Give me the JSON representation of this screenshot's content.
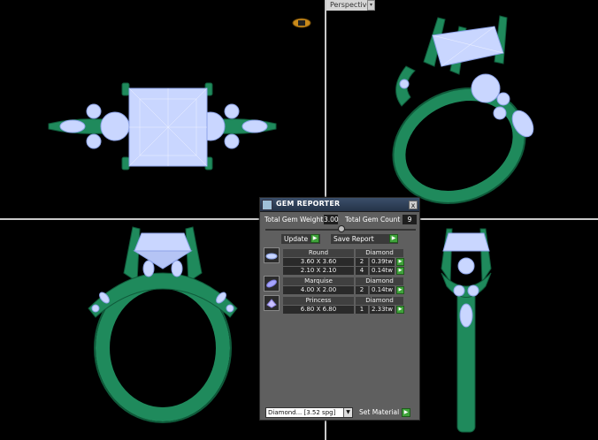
{
  "viewport": {
    "perspective_label": "Perspective",
    "perspective_arrow": "▾"
  },
  "colors": {
    "metal": "#1f8a5c",
    "metal_dark": "#0f5a3a",
    "gem": "#c9d6ff",
    "panel_bg": "#5f5f5f",
    "accent_green": "#3fa23a"
  },
  "gem_reporter": {
    "title": "GEM REPORTER",
    "close": "x",
    "total_gem_weight_label": "Total Gem Weight",
    "total_gem_weight": "3.00",
    "total_gem_count_label": "Total Gem Count",
    "total_gem_count": "9",
    "update_label": "Update",
    "save_report_label": "Save Report",
    "go_icon": "▶",
    "groups": [
      {
        "icon": "round-gem-icon",
        "shape": "Round",
        "material": "Diamond",
        "rows": [
          {
            "size": "3.60 X 3.60",
            "count": "2",
            "weight": "0.39tw"
          },
          {
            "size": "2.10 X 2.10",
            "count": "4",
            "weight": "0.14tw"
          }
        ]
      },
      {
        "icon": "marquise-gem-icon",
        "shape": "Marquise",
        "material": "Diamond",
        "rows": [
          {
            "size": "4.00 X 2.00",
            "count": "2",
            "weight": "0.14tw"
          }
        ]
      },
      {
        "icon": "princess-gem-icon",
        "shape": "Princess",
        "material": "Diamond",
        "rows": [
          {
            "size": "6.80 X 6.80",
            "count": "1",
            "weight": "2.33tw"
          }
        ]
      }
    ],
    "material_select": "Diamond... [3.52 spg]",
    "set_material_label": "Set Material"
  }
}
